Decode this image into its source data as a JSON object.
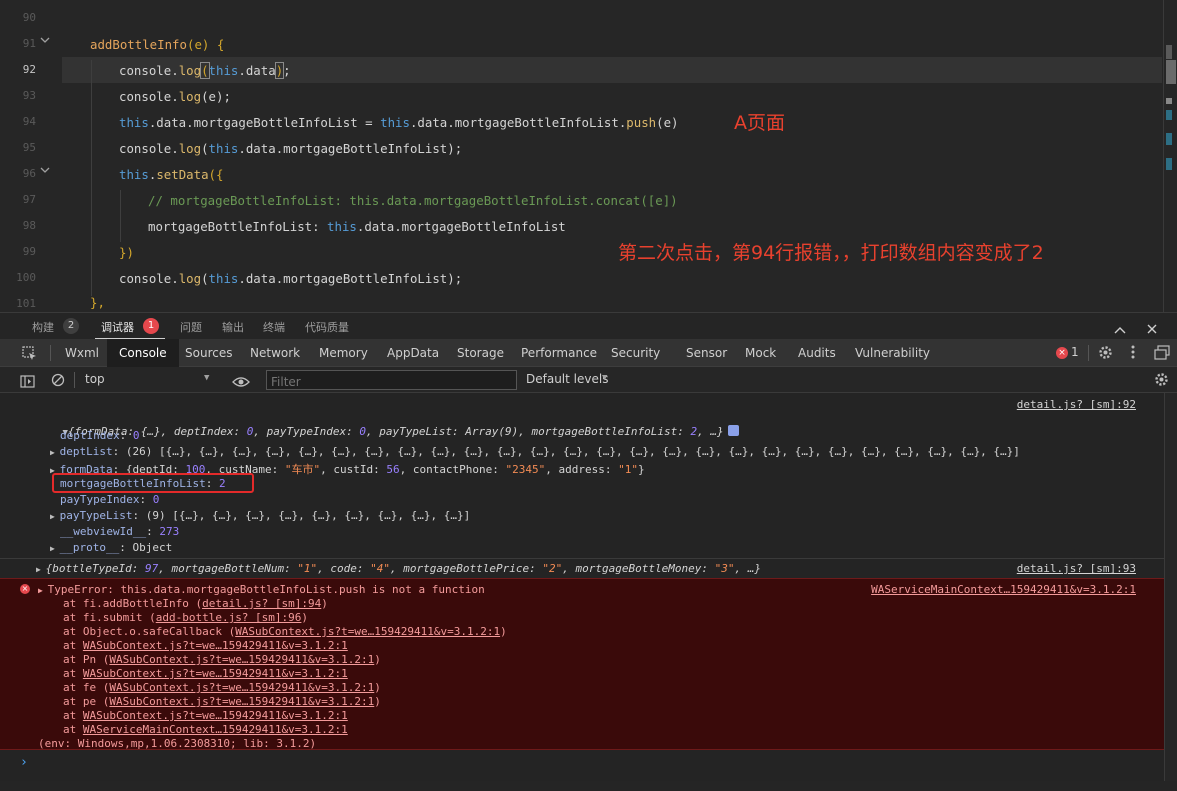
{
  "editor": {
    "line_numbers": [
      "90",
      "91",
      "92",
      "93",
      "94",
      "95",
      "96",
      "97",
      "98",
      "99",
      "100",
      "101"
    ],
    "active_line": "92",
    "lines": {
      "l91": {
        "name": "addBottleInfo",
        "open": "(e) {"
      },
      "l92": {
        "a": "console.",
        "b": "log",
        "c": "(",
        "d": "this",
        "e": ".data",
        "f": ")",
        "g": ";"
      },
      "l93": {
        "a": "console.",
        "b": "log",
        "c": "(e);"
      },
      "l94": {
        "a": "this",
        ".b": ".data.mortgageBottleInfoList = ",
        "c": "this",
        "d": ".data.mortgageBottleInfoList.",
        "e": "push",
        "f": "(e)"
      },
      "l95": {
        "a": "console.",
        "b": "log",
        "c": "(",
        "d": "this",
        "e": ".data.mortgageBottleInfoList);"
      },
      "l96": {
        "a": "this",
        "b": ".",
        "c": "setData",
        "d": "({"
      },
      "l97": "// mortgageBottleInfoList: this.data.mortgageBottleInfoList.concat([e])",
      "l98": {
        "a": "mortgageBottleInfoList: ",
        "b": "this",
        "c": ".data.mortgageBottleInfoList"
      },
      "l99": "})",
      "l100": {
        "a": "console.",
        "b": "log",
        "c": "(",
        "d": "this",
        "e": ".data.mortgageBottleInfoList);"
      },
      "l101": "},"
    },
    "annotation_a": "A页面",
    "annotation_b": "第二次点击，第94行报错，，打印数组内容变成了2"
  },
  "panel_tabs": [
    {
      "label": "构建",
      "count": "2"
    },
    {
      "label": "调试器",
      "count": "1"
    },
    {
      "label": "问题"
    },
    {
      "label": "输出"
    },
    {
      "label": "终端"
    },
    {
      "label": "代码质量"
    }
  ],
  "devtools_tabs": [
    "Wxml",
    "Console",
    "Sources",
    "Network",
    "Memory",
    "AppData",
    "Storage",
    "Performance",
    "Security",
    "Sensor",
    "Mock",
    "Audits",
    "Vulnerability"
  ],
  "error_count": "1",
  "console_toolbar": {
    "context": "top",
    "filter_placeholder": "Filter",
    "levels": "Default levels"
  },
  "console": {
    "src1": "detail.js? [sm]:92",
    "obj_summary": {
      "p1": "{formData: {…}, deptIndex: ",
      "v1": "0",
      "p2": ", payTypeIndex: ",
      "v2": "0",
      "p3": ", payTypeList: Array(9), mortgageBottleInfoList: ",
      "v3": "2",
      "p4": ", …}"
    },
    "deptIndex": {
      "k": "deptIndex",
      "v": "0"
    },
    "deptList": {
      "k": "deptList",
      "v": "(26) [{…}, {…}, {…}, {…}, {…}, {…}, {…}, {…}, {…}, {…}, {…}, {…}, {…}, {…}, {…}, {…}, {…}, {…}, {…}, {…}, {…}, {…}, {…}, {…}, {…}, {…}]"
    },
    "formData": {
      "k": "formData",
      "p1": "{deptId: ",
      "v1": "100",
      "p2": ", custName: ",
      "v2": "\"车市\"",
      "p3": ", custId: ",
      "v3": "56",
      "p4": ", contactPhone: ",
      "v4": "\"2345\"",
      "p5": ", address: ",
      "v5": "\"1\"",
      "p6": "}"
    },
    "mortgage": {
      "k": "mortgageBottleInfoList",
      "v": "2"
    },
    "payTypeIndex": {
      "k": "payTypeIndex",
      "v": "0"
    },
    "payTypeList": {
      "k": "payTypeList",
      "v": "(9) [{…}, {…}, {…}, {…}, {…}, {…}, {…}, {…}, {…}]"
    },
    "webviewId": {
      "k": "__webviewId__",
      "v": "273"
    },
    "proto": {
      "k": "__proto__",
      "v": "Object"
    },
    "bottle_line": {
      "p1": "{bottleTypeId: ",
      "v1": "97",
      "p2": ", mortgageBottleNum: ",
      "v2": "\"1\"",
      "p3": ", code: ",
      "v3": "\"4\"",
      "p4": ", mortgageBottlePrice: ",
      "v4": "\"2\"",
      "p5": ", mortgageBottleMoney: ",
      "v5": "\"3\"",
      "p6": ", …}"
    },
    "src2": "detail.js? [sm]:93",
    "error": {
      "message": "TypeError: this.data.mortgageBottleInfoList.push is not a function",
      "source": "WAServiceMainContext…159429411&v=3.1.2:1",
      "stack": [
        {
          "pre": "at fi.addBottleInfo (",
          "link": "detail.js? [sm]:94",
          "post": ")"
        },
        {
          "pre": "at fi.submit (",
          "link": "add-bottle.js? [sm]:96",
          "post": ")"
        },
        {
          "pre": "at Object.o.safeCallback (",
          "link": "WASubContext.js?t=we…159429411&v=3.1.2:1",
          "post": ")"
        },
        {
          "pre": "at ",
          "link": "WASubContext.js?t=we…159429411&v=3.1.2:1",
          "post": ""
        },
        {
          "pre": "at Pn (",
          "link": "WASubContext.js?t=we…159429411&v=3.1.2:1",
          "post": ")"
        },
        {
          "pre": "at ",
          "link": "WASubContext.js?t=we…159429411&v=3.1.2:1",
          "post": ""
        },
        {
          "pre": "at fe (",
          "link": "WASubContext.js?t=we…159429411&v=3.1.2:1",
          "post": ")"
        },
        {
          "pre": "at pe (",
          "link": "WASubContext.js?t=we…159429411&v=3.1.2:1",
          "post": ")"
        },
        {
          "pre": "at ",
          "link": "WASubContext.js?t=we…159429411&v=3.1.2:1",
          "post": ""
        },
        {
          "pre": "at ",
          "link": "WAServiceMainContext…159429411&v=3.1.2:1",
          "post": ""
        }
      ],
      "env": "(env: Windows,mp,1.06.2308310; lib: 3.1.2)"
    },
    "prompt": "›"
  },
  "colors": {
    "accent_red": "#e8412e",
    "error_bg": "#3a0a0a",
    "badge_red": "#e5484d"
  }
}
